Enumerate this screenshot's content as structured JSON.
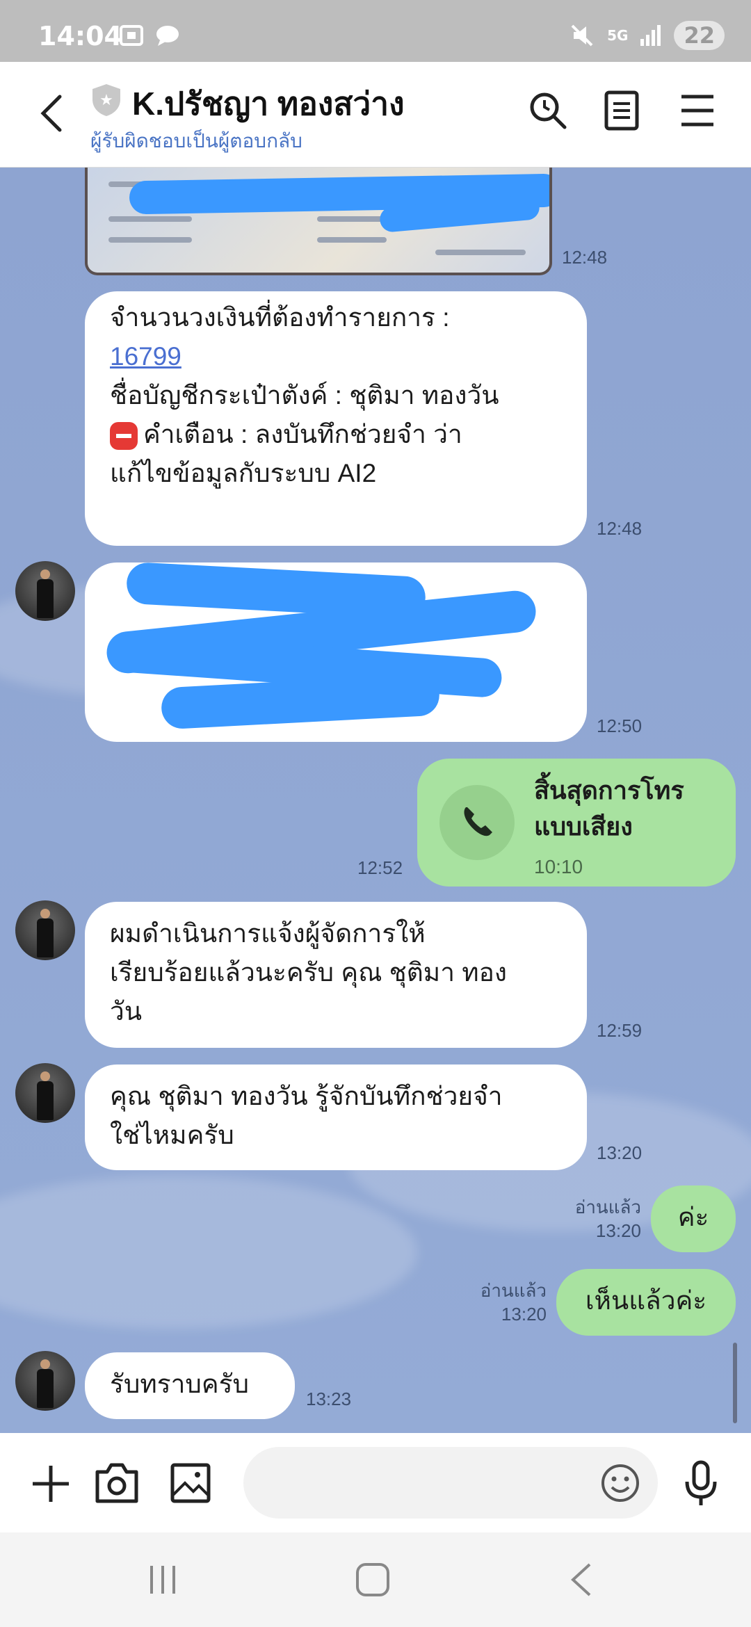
{
  "status_bar": {
    "time": "14:04",
    "network": "5G",
    "battery": "22"
  },
  "header": {
    "title": "K.ปรัชญา ทองสว่าง",
    "subtitle": "ผู้รับผิดชอบเป็นผู้ตอบกลับ"
  },
  "messages": {
    "m0": {
      "time": "12:48"
    },
    "m1": {
      "line1": "จำนวนวงเงินที่ต้องทำรายการ :",
      "amount": "16799",
      "line3": "ชื่อบัญชีกระเป๋าตังค์ : ชุติมา ทองวัน",
      "line4": "คำเตือน : ลงบันทึกช่วยจำ ว่า",
      "line5": "แก้ไขข้อมูลกับระบบ AI2",
      "time": "12:48"
    },
    "m2": {
      "time": "12:50"
    },
    "m3": {
      "title_line1": "สิ้นสุดการโทร",
      "title_line2": "แบบเสียง",
      "duration": "10:10",
      "time": "12:52"
    },
    "m4": {
      "line1": "ผมดำเนินการแจ้งผู้จัดการให้",
      "line2": "เรียบร้อยแล้วนะครับ คุณ ชุติมา ทอง",
      "line3": "วัน",
      "time": "12:59"
    },
    "m5": {
      "line1": "คุณ ชุติมา ทองวัน รู้จักบันทึกช่วยจำ",
      "line2": "ใช่ไหมครับ",
      "time": "13:20"
    },
    "m6": {
      "text": "ค่ะ",
      "read": "อ่านแล้ว",
      "time": "13:20"
    },
    "m7": {
      "text": "เห็นแล้วค่ะ",
      "read": "อ่านแล้ว",
      "time": "13:20"
    },
    "m8": {
      "text": "รับทราบครับ",
      "time": "13:23"
    }
  },
  "colors": {
    "chat_bg": "#8ea4d1",
    "my_bubble": "#a8e2a0",
    "their_bubble": "#ffffff",
    "link": "#4a6fd1",
    "redaction": "#3a98ff"
  },
  "icons": {
    "back": "chevron-left-icon",
    "search": "search-icon",
    "notes": "notes-icon",
    "menu": "hamburger-icon",
    "plus": "plus-icon",
    "camera": "camera-icon",
    "image": "image-icon",
    "emoji": "emoji-icon",
    "mic": "microphone-icon"
  }
}
